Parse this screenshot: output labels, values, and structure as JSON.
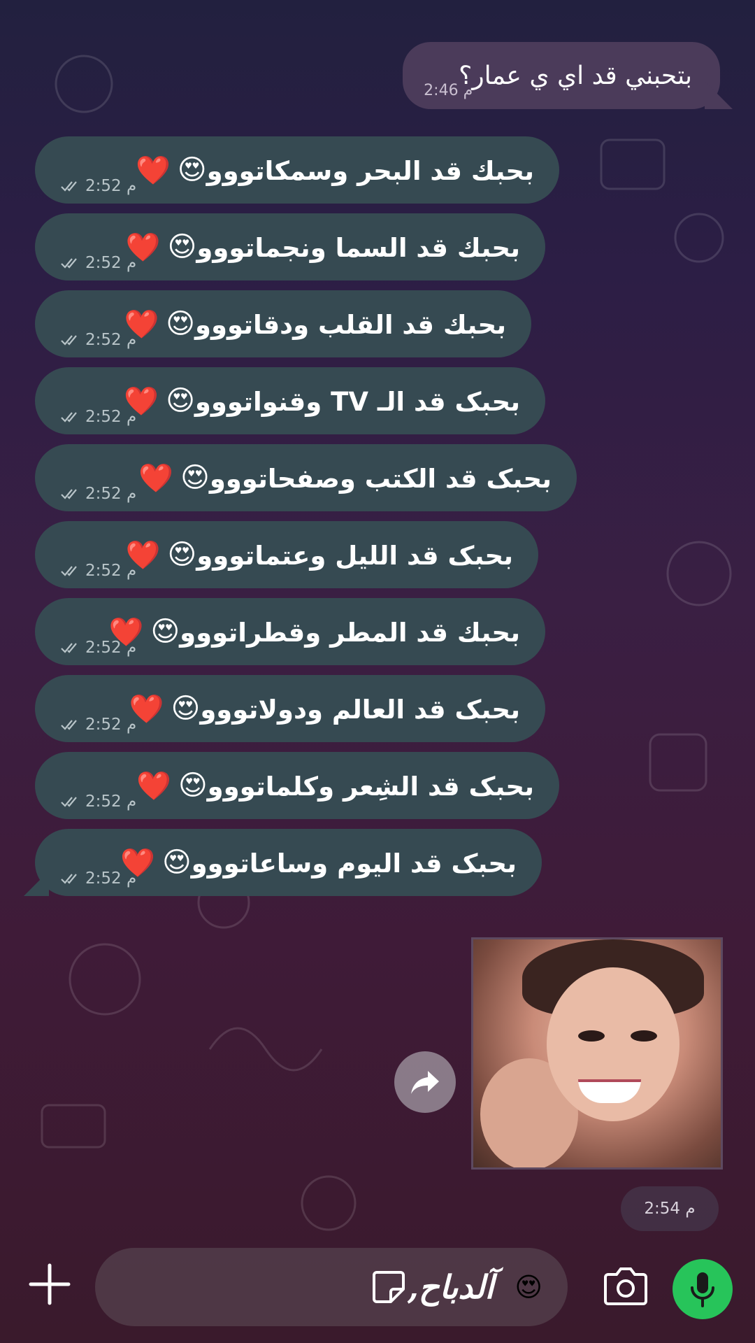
{
  "incoming": {
    "text": "بتحبني قد اي ي عمار؟",
    "time": "2:46 م"
  },
  "messages": [
    {
      "text": "بحبك قد البحر وسمكاتووو",
      "time": "2:52 م"
    },
    {
      "text": "بحبك قد السما ونجماتووو",
      "time": "2:52 م"
    },
    {
      "text": "بحبك قد القلب ودقاتووو",
      "time": "2:52 م"
    },
    {
      "text": "بحبک قد الـ TV وقنواتووو",
      "time": "2:52 م"
    },
    {
      "text": "بحبک قد الکتب وصفحاتووو",
      "time": "2:52 م"
    },
    {
      "text": "بحبک قد الليل وعتماتووو",
      "time": "2:52 م"
    },
    {
      "text": "بحبك قد المطر وقطراتووو",
      "time": "2:52 م"
    },
    {
      "text": "بحبک قد العالم ودولاتووو",
      "time": "2:52 م"
    },
    {
      "text": "بحبک قد الشِعر وکلماتووو",
      "time": "2:52 م"
    },
    {
      "text": "بحبک قد اليوم وساعاتووو",
      "time": "2:52 م"
    }
  ],
  "message_emoji": {
    "face": "😍",
    "heart": "❤️"
  },
  "photo_message": {
    "time": "2:54 م"
  },
  "composer": {
    "text": "آلدباح,",
    "emoji": "😍"
  },
  "icons": {
    "plus": "plus-icon",
    "sticker": "sticker-icon",
    "camera": "camera-icon",
    "mic": "microphone-icon",
    "forward": "forward-icon",
    "read": "double-check-icon"
  },
  "colors": {
    "mic_button": "#27c45a",
    "outgoing_bubble": "#364a52",
    "incoming_bubble": "#4b3b5a"
  }
}
